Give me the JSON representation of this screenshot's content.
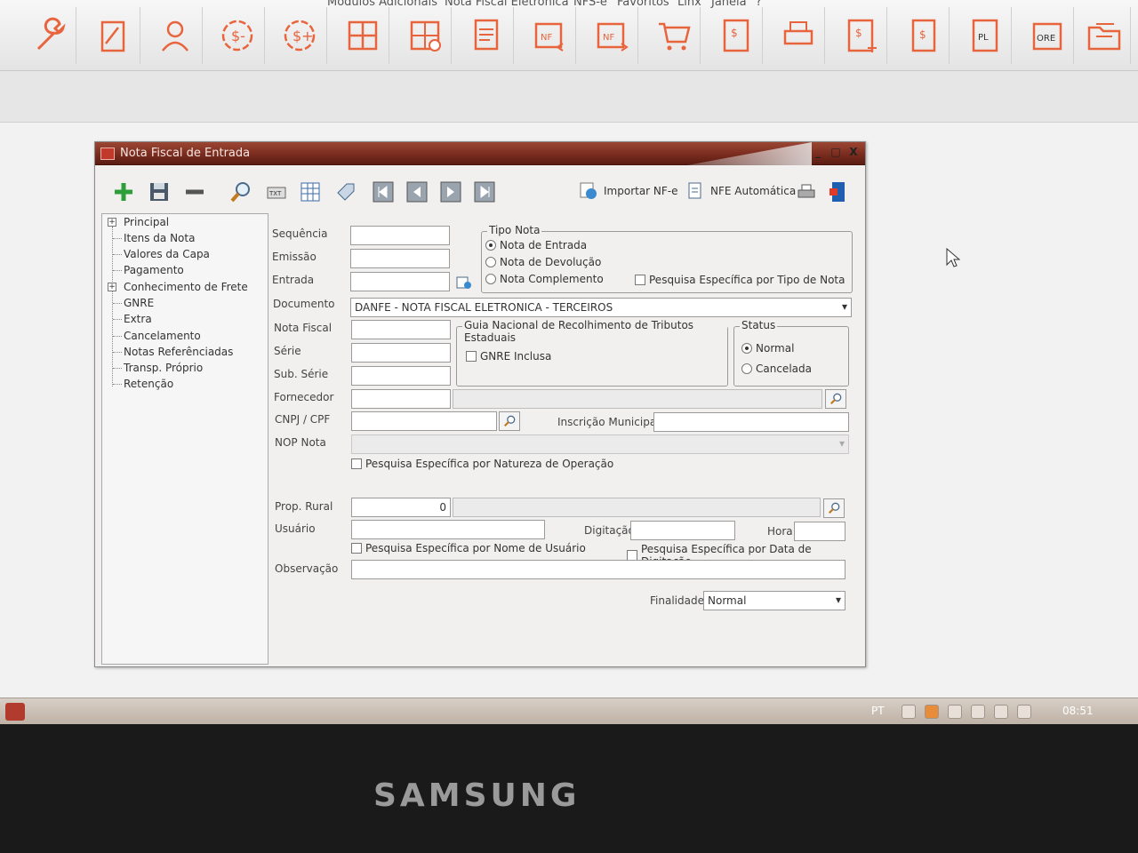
{
  "menubar": {
    "items": [
      "Modulos Adicionais",
      "Nota Fiscal Eletronica",
      "NFS-e",
      "Favoritos",
      "Linx",
      "Janela",
      "?"
    ]
  },
  "window": {
    "title": "Nota Fiscal de Entrada",
    "controls": [
      "_",
      "□",
      "X"
    ]
  },
  "window_toolbar": {
    "importar_label": "Importar NF-e",
    "nfe_auto_label": "NFE Automática"
  },
  "tree": {
    "items": [
      {
        "label": "Principal",
        "expandable": true
      },
      {
        "label": "Itens da Nota",
        "expandable": false
      },
      {
        "label": "Valores da Capa",
        "expandable": false
      },
      {
        "label": "Pagamento",
        "expandable": false
      },
      {
        "label": "Conhecimento de Frete",
        "expandable": true
      },
      {
        "label": "GNRE",
        "expandable": false
      },
      {
        "label": "Extra",
        "expandable": false
      },
      {
        "label": "Cancelamento",
        "expandable": false
      },
      {
        "label": "Notas Referênciadas",
        "expandable": false
      },
      {
        "label": "Transp. Próprio",
        "expandable": false
      },
      {
        "label": "Retenção",
        "expandable": false
      }
    ]
  },
  "form": {
    "sequencia_label": "Sequência",
    "emissao_label": "Emissão",
    "entrada_label": "Entrada",
    "documento_label": "Documento",
    "documento_value": "DANFE - NOTA FISCAL ELETRONICA - TERCEIROS",
    "nota_fiscal_label": "Nota Fiscal",
    "serie_label": "Série",
    "sub_serie_label": "Sub. Série",
    "fornecedor_label": "Fornecedor",
    "cnpj_label": "CNPJ / CPF",
    "inscricao_label": "Inscrição Municipal",
    "nop_label": "NOP Nota",
    "pesquisa_natureza": "Pesquisa Específica por Natureza de Operação",
    "prop_rural_label": "Prop. Rural",
    "prop_rural_value": "0",
    "usuario_label": "Usuário",
    "digitacao_label": "Digitação",
    "hora_label": "Hora",
    "pesquisa_usuario": "Pesquisa Específica por Nome de Usuário",
    "pesquisa_data": "Pesquisa Específica por Data de Digitação",
    "observacao_label": "Observação",
    "finalidade_label": "Finalidade:",
    "finalidade_value": "Normal"
  },
  "tipo_nota": {
    "title": "Tipo Nota",
    "options": [
      "Nota de Entrada",
      "Nota de Devolução",
      "Nota Complemento"
    ],
    "selected": 0,
    "pesquisa_label": "Pesquisa Específica por Tipo de Nota"
  },
  "gnre": {
    "title": "Guia Nacional de Recolhimento de Tributos Estaduais",
    "checkbox_label": "GNRE Inclusa"
  },
  "status": {
    "title": "Status",
    "options": [
      "Normal",
      "Cancelada"
    ],
    "selected": 0
  },
  "taskbar": {
    "lang": "PT",
    "clock": "08:51"
  },
  "monitor": {
    "brand": "SAMSUNG"
  },
  "colors": {
    "titlebar": "#7a2c1e",
    "toolbar_icon": "#e8643c",
    "nav_green": "#2e9e3a"
  }
}
